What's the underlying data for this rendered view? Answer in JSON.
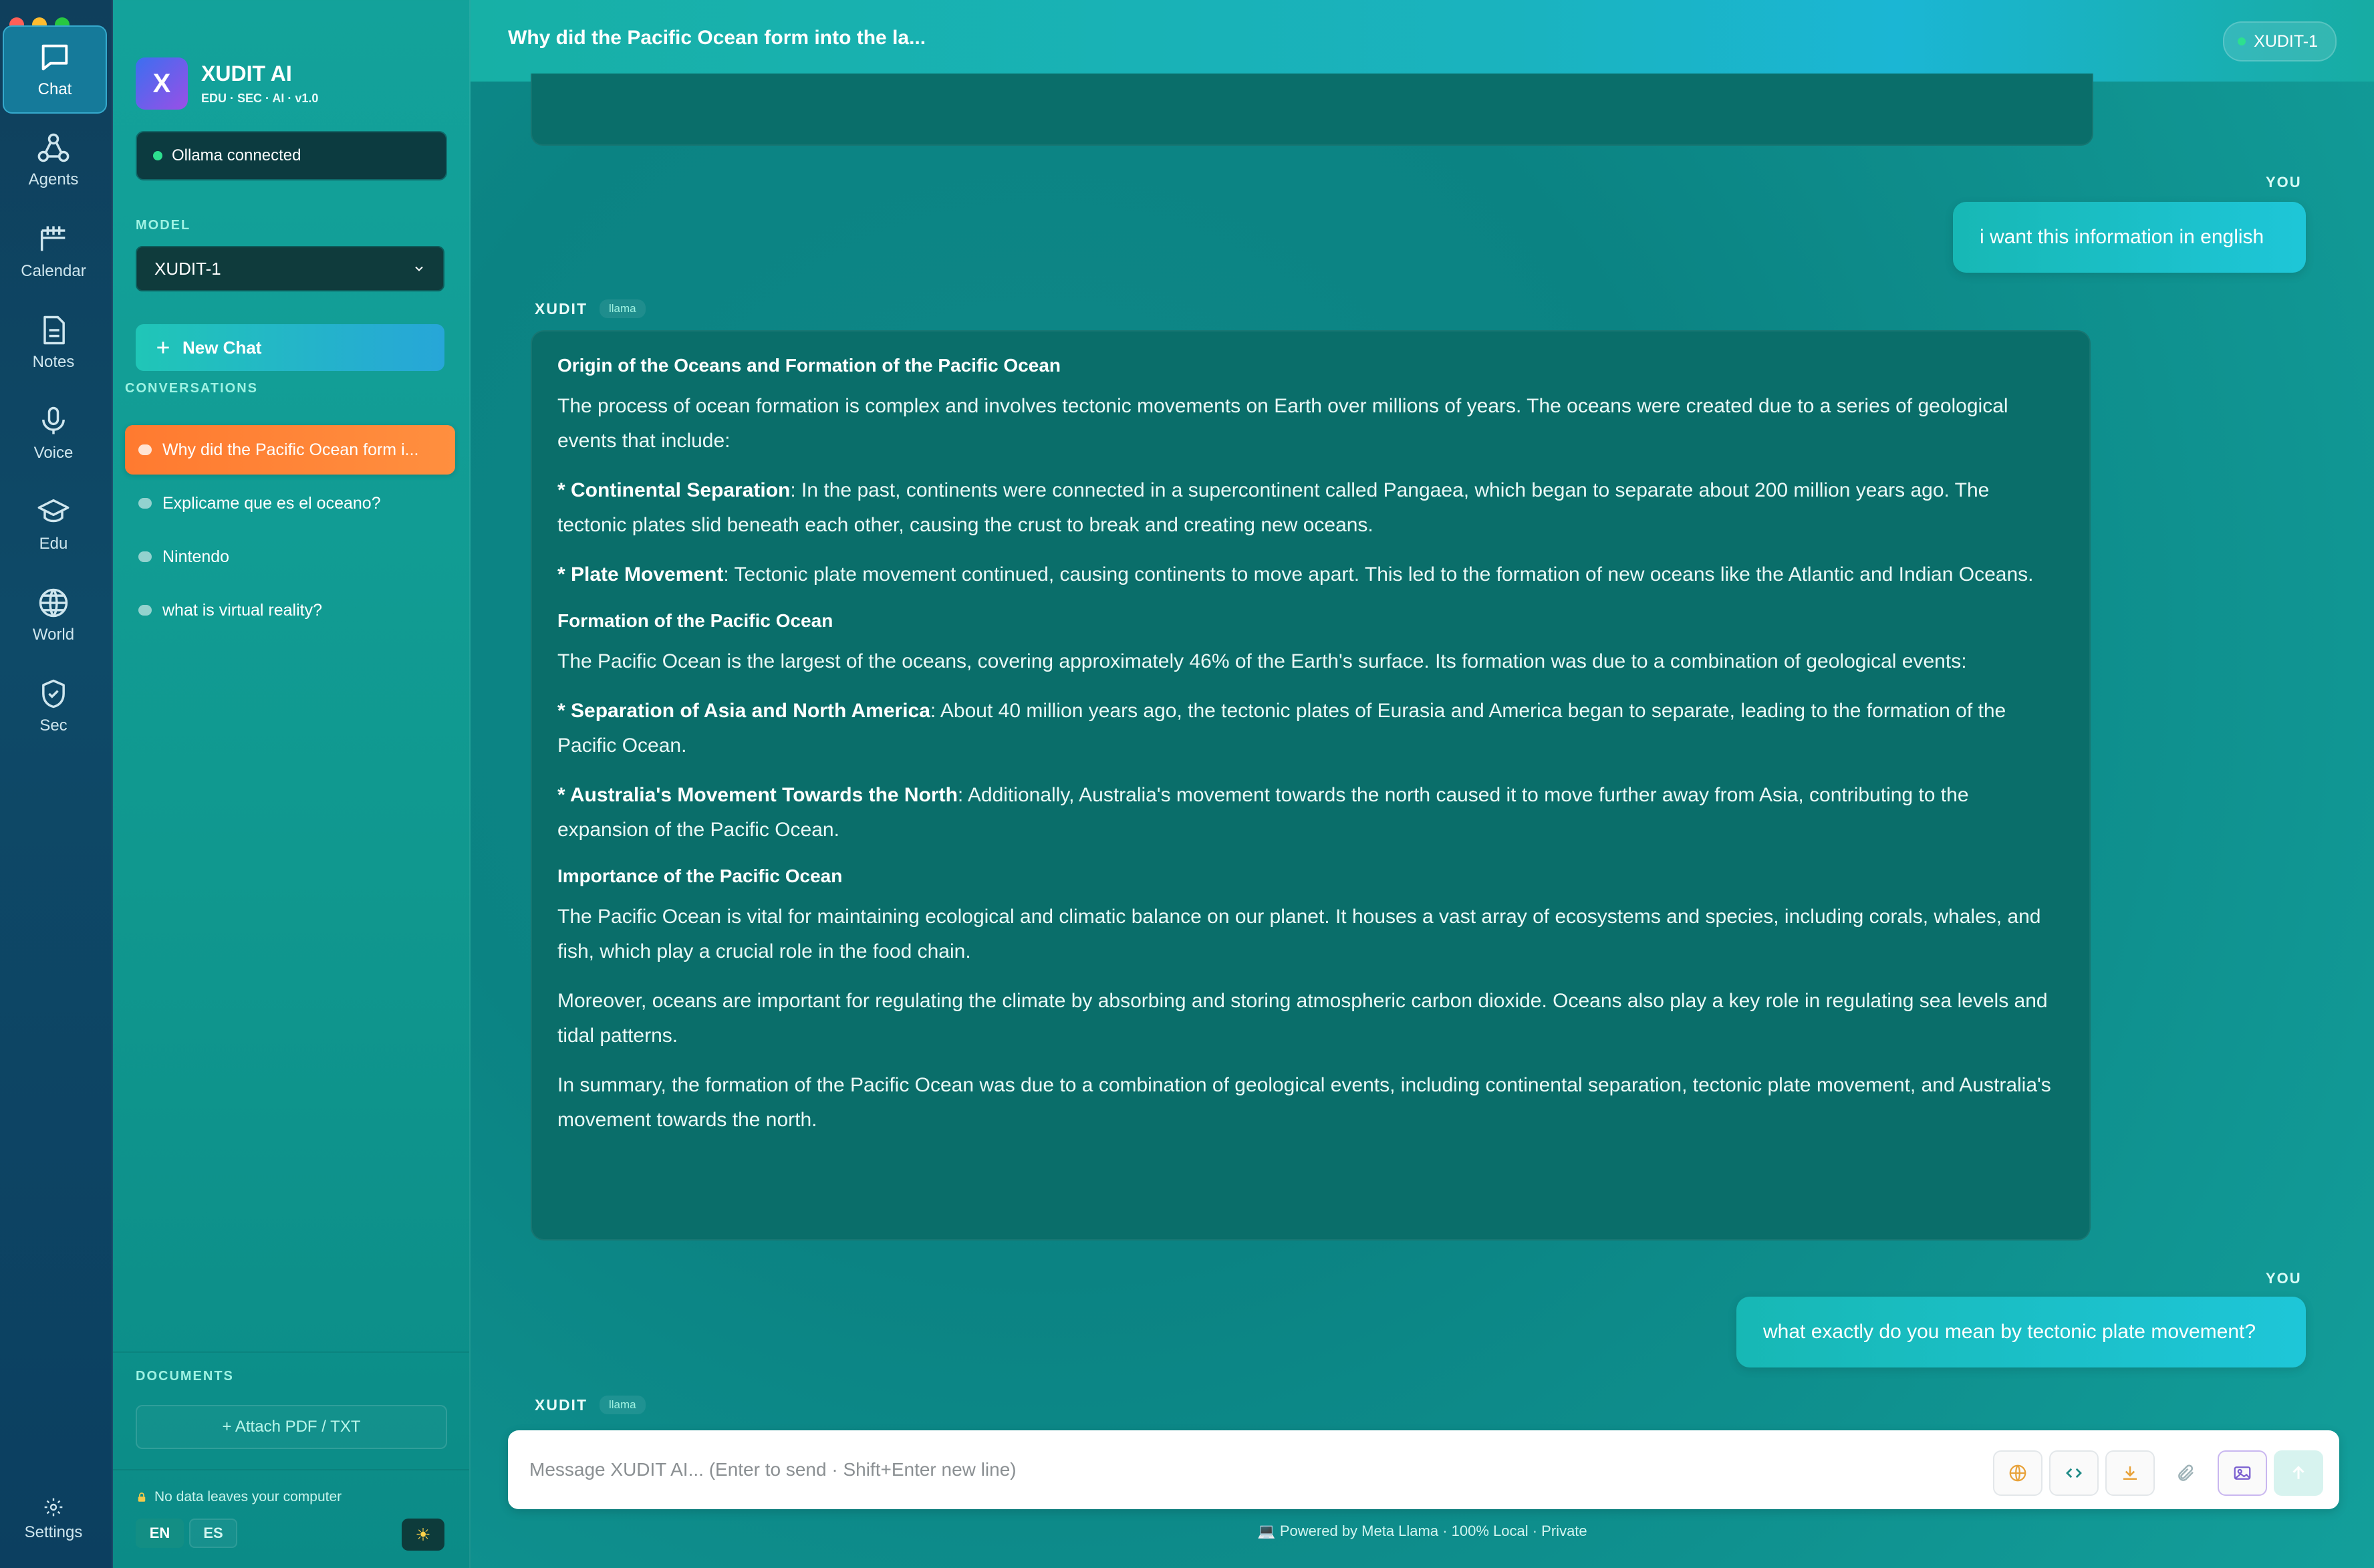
{
  "rail": {
    "items": [
      {
        "label": "Chat",
        "icon": "chat-icon"
      },
      {
        "label": "Agents",
        "icon": "agents-icon"
      },
      {
        "label": "Calendar",
        "icon": "calendar-icon"
      },
      {
        "label": "Notes",
        "icon": "notes-icon"
      },
      {
        "label": "Voice",
        "icon": "microphone-icon"
      },
      {
        "label": "Edu",
        "icon": "graduation-cap-icon"
      },
      {
        "label": "World",
        "icon": "globe-icon"
      },
      {
        "label": "Sec",
        "icon": "shield-icon"
      }
    ],
    "settings_label": "Settings"
  },
  "sidebar": {
    "brand_initial": "X",
    "brand_title": "XUDIT AI",
    "brand_subtitle": "EDU · SEC · AI · v1.0",
    "status": "Ollama connected",
    "model_label": "MODEL",
    "model_value": "XUDIT-1",
    "new_chat_label": "New Chat",
    "conversations_label": "CONVERSATIONS",
    "conversations": [
      {
        "title": "Why did the Pacific Ocean form i...",
        "active": true
      },
      {
        "title": "Explicame que es el oceano?",
        "active": false
      },
      {
        "title": "Nintendo",
        "active": false
      },
      {
        "title": "what is virtual reality?",
        "active": false
      }
    ],
    "documents_label": "DOCUMENTS",
    "attach_label": "+ Attach PDF / TXT",
    "privacy_note": "No data leaves your computer",
    "lang_en": "EN",
    "lang_es": "ES"
  },
  "header": {
    "chat_title": "Why did the Pacific Ocean form into the la...",
    "model_badge": "XUDIT-1"
  },
  "messages": {
    "you_label": "YOU",
    "ai_name": "XUDIT",
    "ai_badge": "llama",
    "user_1": "i want this information in english",
    "user_2": "what exactly do you mean by tectonic plate movement?",
    "ai_response": {
      "h1": "Origin of the Oceans and Formation of the Pacific Ocean",
      "p1": "The process of ocean formation is complex and involves tectonic movements on Earth over millions of years. The oceans were created due to a series of geological events that include:",
      "b1": "* Continental Separation",
      "p2": ": In the past, continents were connected in a supercontinent called Pangaea, which began to separate about 200 million years ago. The tectonic plates slid beneath each other, causing the crust to break and creating new oceans.",
      "b2": "* Plate Movement",
      "p3": ": Tectonic plate movement continued, causing continents to move apart. This led to the formation of new oceans like the Atlantic and Indian Oceans.",
      "h2": "Formation of the Pacific Ocean",
      "p4": "The Pacific Ocean is the largest of the oceans, covering approximately 46% of the Earth's surface. Its formation was due to a combination of geological events:",
      "b3": "* Separation of Asia and North America",
      "p5": ": About 40 million years ago, the tectonic plates of Eurasia and America began to separate, leading to the formation of the Pacific Ocean.",
      "b4": "* Australia's Movement Towards the North",
      "p6": ": Additionally, Australia's movement towards the north caused it to move further away from Asia, contributing to the expansion of the Pacific Ocean.",
      "h3": "Importance of the Pacific Ocean",
      "p7": "The Pacific Ocean is vital for maintaining ecological and climatic balance on our planet. It houses a vast array of ecosystems and species, including corals, whales, and fish, which play a crucial role in the food chain.",
      "p8": "Moreover, oceans are important for regulating the climate by absorbing and storing atmospheric carbon dioxide. Oceans also play a key role in regulating sea levels and tidal patterns.",
      "p9": "In summary, the formation of the Pacific Ocean was due to a combination of geological events, including continental separation, tectonic plate movement, and Australia's movement towards the north."
    }
  },
  "composer": {
    "placeholder": "Message XUDIT AI... (Enter to send · Shift+Enter new line)",
    "tools": [
      "globe-icon",
      "code-icon",
      "download-icon",
      "paperclip-icon",
      "image-icon",
      "send-arrow-icon"
    ]
  },
  "footer_note": "Powered by Meta Llama · 100% Local · Private",
  "colors": {
    "accent_orange": "#ff7a30",
    "accent_teal": "#20c6b7",
    "status_green": "#2de08f"
  }
}
